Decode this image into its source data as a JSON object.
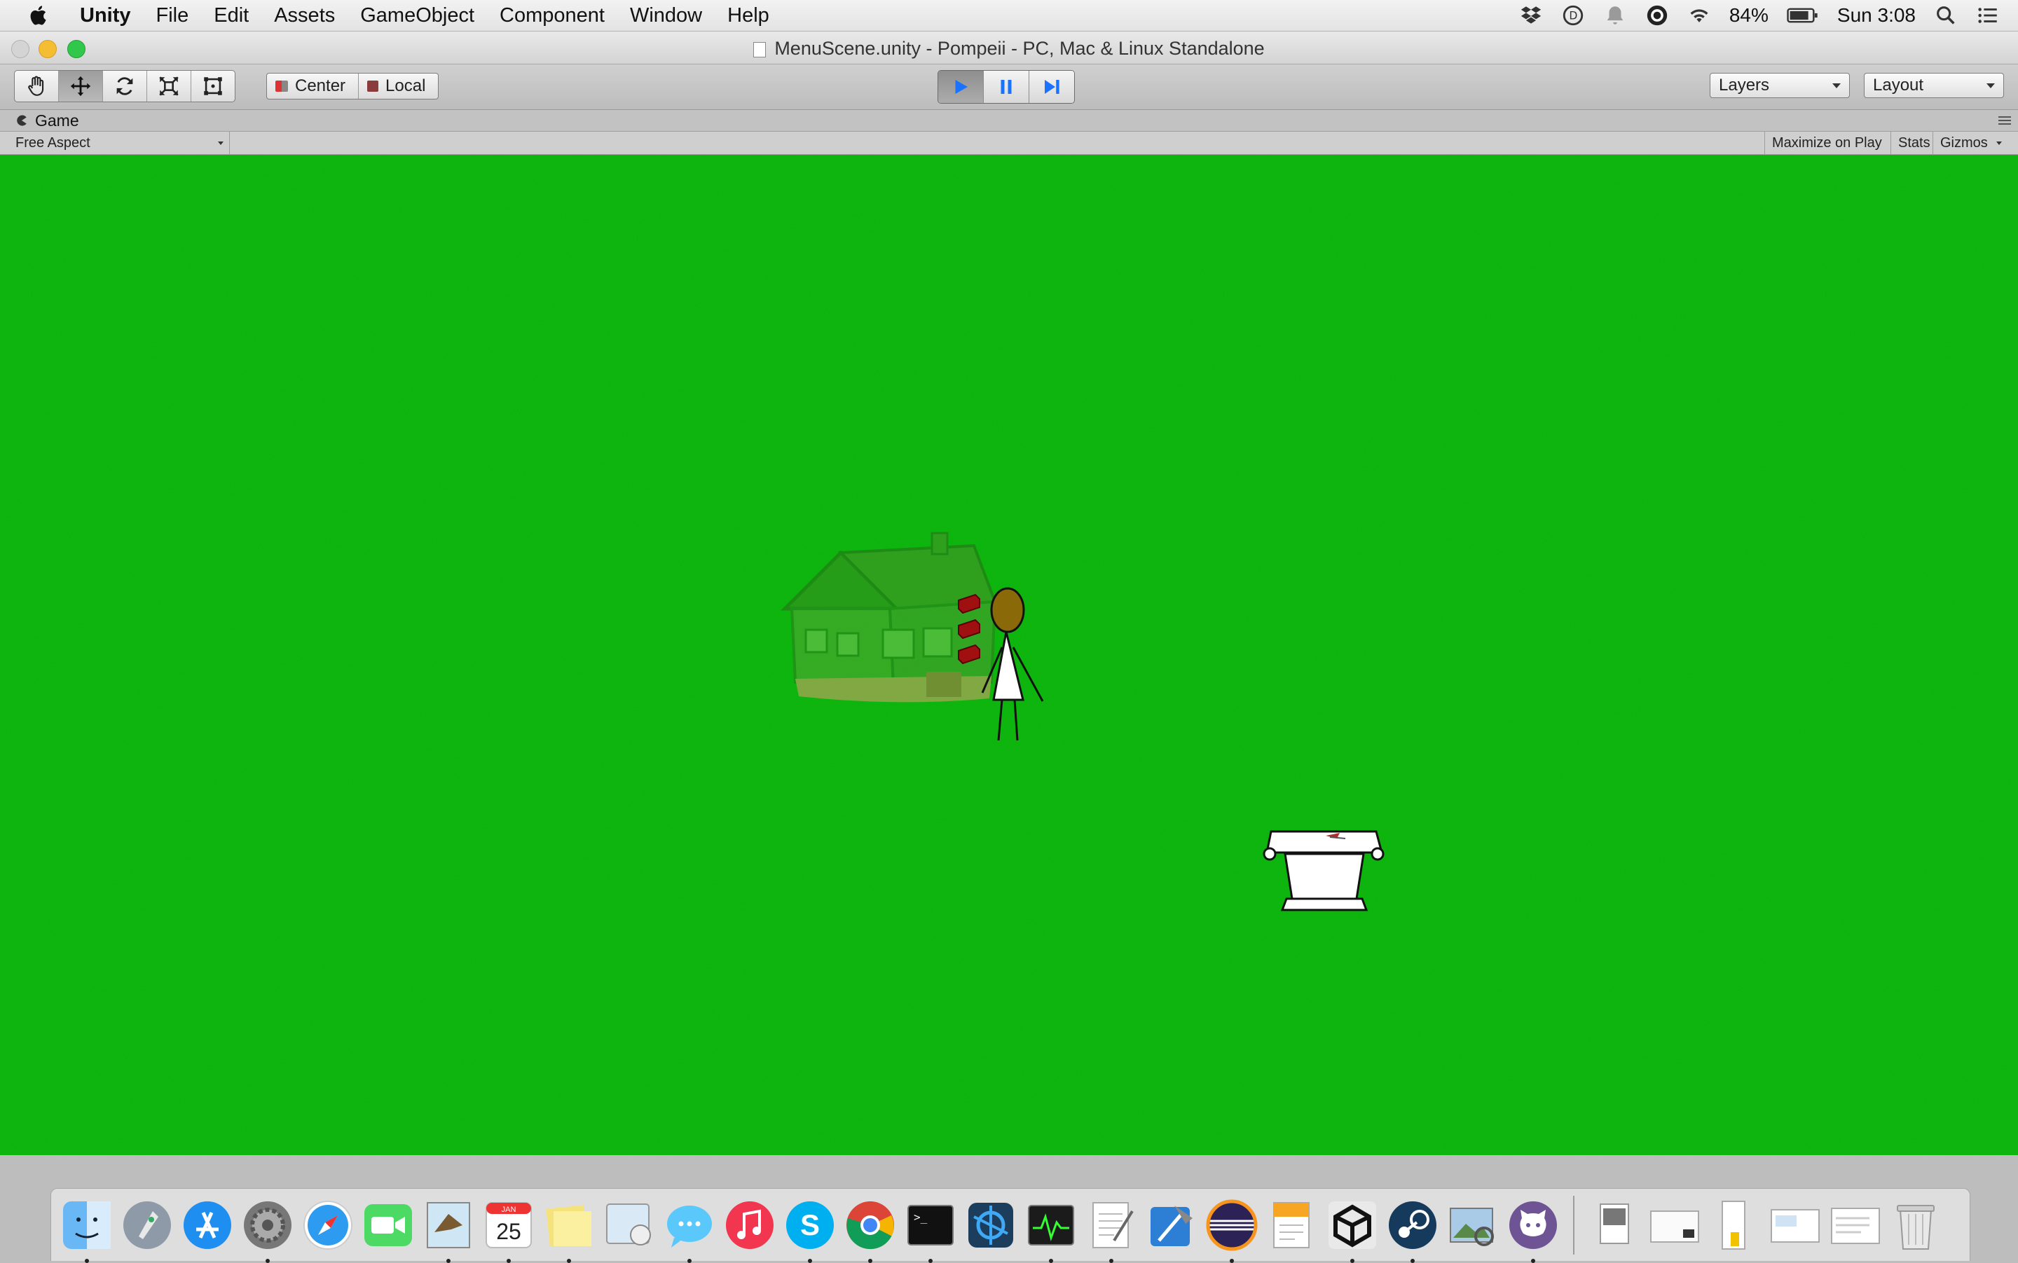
{
  "menubar": {
    "app_name": "Unity",
    "menus": [
      "File",
      "Edit",
      "Assets",
      "GameObject",
      "Component",
      "Window",
      "Help"
    ],
    "status": {
      "battery": "84%",
      "clock": "Sun 3:08"
    }
  },
  "window": {
    "title": "MenuScene.unity - Pompeii - PC, Mac & Linux Standalone"
  },
  "toolbar": {
    "pivot_center": "Center",
    "pivot_local": "Local",
    "layers_label": "Layers",
    "layout_label": "Layout",
    "active_tool": "move-tool",
    "play_state": "playing"
  },
  "game_view": {
    "tab_label": "Game",
    "aspect": "Free Aspect",
    "maximize_label": "Maximize on Play",
    "stats_label": "Stats",
    "gizmos_label": "Gizmos",
    "background_color": "#10b010"
  },
  "colors": {
    "play_accent": "#1a73ff",
    "grass": "#10b010"
  },
  "dock": {
    "apps": [
      "finder-icon",
      "launchpad-icon",
      "app-store-icon",
      "system-preferences-icon",
      "safari-icon",
      "facetime-icon",
      "preview-eagle-icon",
      "calendar-icon",
      "stickies-icon",
      "photo-booth-icon",
      "messages-icon",
      "itunes-icon",
      "skype-icon",
      "chrome-icon",
      "terminal-icon",
      "battle-net-icon",
      "activity-monitor-icon",
      "textedit-icon",
      "xcode-icon",
      "eclipse-icon",
      "pages-icon",
      "unity-icon",
      "steam-icon",
      "preview-icon",
      "github-icon"
    ],
    "calendar_month": "JAN",
    "calendar_day": "25",
    "terminal_prompt": ">_"
  }
}
